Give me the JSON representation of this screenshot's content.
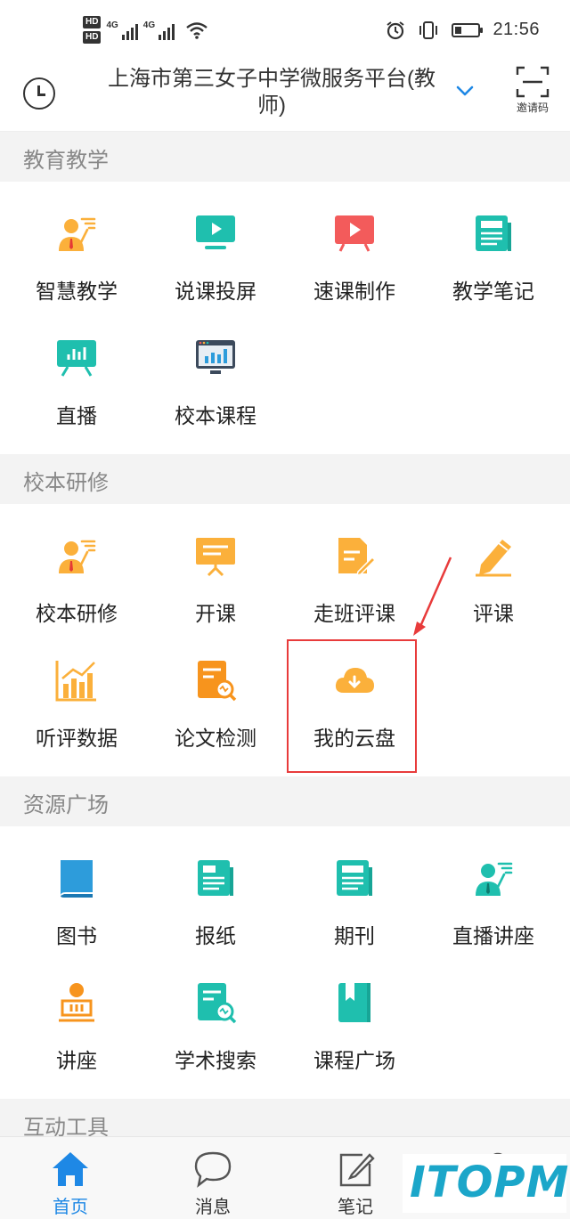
{
  "status_bar": {
    "hd1": "HD",
    "hd2": "HD",
    "net1": "4G",
    "net2": "4G",
    "time": "21:56",
    "battery_level": 0.3
  },
  "header": {
    "title_line1": "上海市第三女子中学微服务平台(教",
    "title_line2": "师)",
    "invite_label": "邀请码"
  },
  "sections": [
    {
      "title": "教育教学",
      "items": [
        {
          "label": "智慧教学",
          "icon": "teacher-presenting-icon"
        },
        {
          "label": "说课投屏",
          "icon": "screen-play-icon"
        },
        {
          "label": "速课制作",
          "icon": "video-play-icon"
        },
        {
          "label": "教学笔记",
          "icon": "notes-document-icon"
        },
        {
          "label": "直播",
          "icon": "live-board-icon"
        },
        {
          "label": "校本课程",
          "icon": "monitor-chart-icon"
        }
      ]
    },
    {
      "title": "校本研修",
      "items": [
        {
          "label": "校本研修",
          "icon": "teacher-presenting-icon"
        },
        {
          "label": "开课",
          "icon": "presentation-board-icon"
        },
        {
          "label": "走班评课",
          "icon": "document-edit-icon"
        },
        {
          "label": "评课",
          "icon": "pencil-icon"
        },
        {
          "label": "听评数据",
          "icon": "bar-chart-icon"
        },
        {
          "label": "论文检测",
          "icon": "document-search-icon"
        },
        {
          "label": "我的云盘",
          "icon": "cloud-download-icon"
        }
      ]
    },
    {
      "title": "资源广场",
      "items": [
        {
          "label": "图书",
          "icon": "book-icon"
        },
        {
          "label": "报纸",
          "icon": "newspaper-icon"
        },
        {
          "label": "期刊",
          "icon": "journal-icon"
        },
        {
          "label": "直播讲座",
          "icon": "lecture-presenter-icon"
        },
        {
          "label": "讲座",
          "icon": "podium-speaker-icon"
        },
        {
          "label": "学术搜索",
          "icon": "academic-search-icon"
        },
        {
          "label": "课程广场",
          "icon": "bookmark-book-icon"
        }
      ]
    },
    {
      "title": "互动工具",
      "items": []
    }
  ],
  "tabbar": {
    "tabs": [
      {
        "label": "首页",
        "icon": "home-icon"
      },
      {
        "label": "消息",
        "icon": "chat-bubble-icon"
      },
      {
        "label": "笔记",
        "icon": "note-edit-icon"
      },
      {
        "label": "",
        "icon": "profile-icon"
      }
    ]
  },
  "watermark": "ITOPM",
  "colors": {
    "accent": "#1e88e5",
    "orange": "#fbb03b",
    "teal": "#1fbfae",
    "red": "#f35b5b",
    "blue": "#2d9cdb",
    "highlight": "#e83b3b"
  }
}
